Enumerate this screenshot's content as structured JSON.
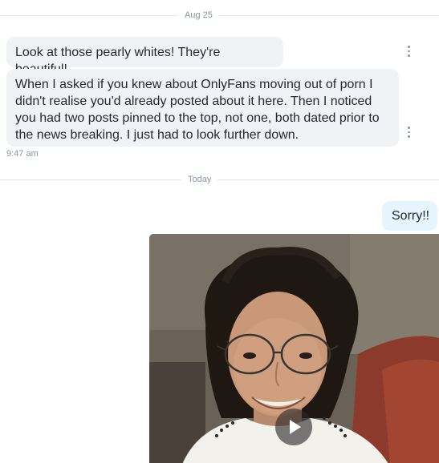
{
  "chat": {
    "date_divider_1": "Aug 25",
    "date_divider_2": "Today",
    "messages_in": [
      {
        "text": "Look at those pearly whites! They're beautiful!"
      },
      {
        "text": "When I asked if you knew about OnlyFans moving out of porn I didn't realise you'd already posted about it here. Then I noticed you had two posts pinned to the top, not one, both dated prior to the news breaking. I just had to look further down."
      }
    ],
    "incoming_time": "9:47 am",
    "messages_out": [
      {
        "text": "Sorry!!"
      }
    ],
    "media": {
      "type": "video",
      "play_icon": "play-icon"
    }
  },
  "colors": {
    "incoming_bubble": "#f0f2f5",
    "outgoing_bubble": "#e6f5fd",
    "muted_text": "#8a96a3",
    "message_text": "#242a30"
  }
}
